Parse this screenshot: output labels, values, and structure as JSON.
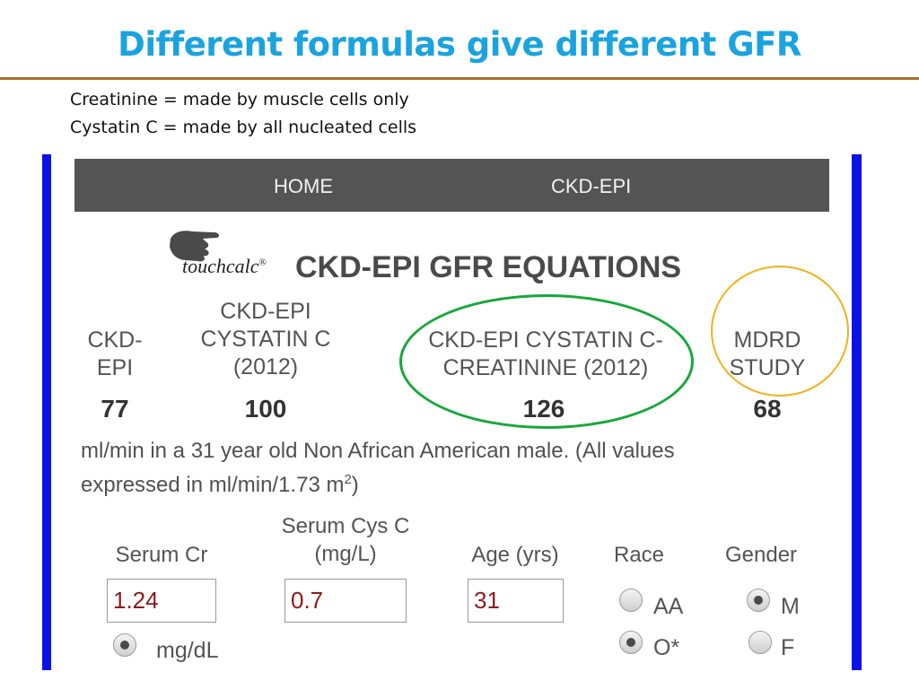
{
  "slide": {
    "title": "Different formulas give different GFR",
    "notes": [
      "Creatinine = made by muscle cells only",
      "Cystatin C = made by all nucleated cells"
    ]
  },
  "nav": {
    "items": [
      "HOME",
      "CKD-EPI"
    ]
  },
  "app": {
    "brand": "touchcalc",
    "brand_mark": "®",
    "title": "CKD-EPI GFR EQUATIONS"
  },
  "results": [
    {
      "label_lines": [
        "CKD-",
        "EPI"
      ],
      "value": "77"
    },
    {
      "label_lines": [
        "CKD-EPI",
        "CYSTATIN C",
        "(2012)"
      ],
      "value": "100"
    },
    {
      "label_lines": [
        "CKD-EPI CYSTATIN C-",
        "CREATININE (2012)"
      ],
      "value": "126"
    },
    {
      "label_lines": [
        "MDRD",
        "STUDY"
      ],
      "value": "68"
    }
  ],
  "description": {
    "line1": "ml/min in a 31 year old Non African American male. (All values",
    "line2": "expressed in ml/min/1.73 m",
    "superscript": "2",
    "line2_end": ")"
  },
  "form": {
    "serum_cr": {
      "label": "Serum Cr",
      "value": "1.24"
    },
    "serum_cys": {
      "label_lines": [
        "Serum Cys C",
        "(mg/L)"
      ],
      "value": "0.7"
    },
    "age": {
      "label": "Age (yrs)",
      "value": "31"
    },
    "units": {
      "label": "mg/dL",
      "checked": true
    },
    "race": {
      "label": "Race",
      "options": [
        {
          "label": "AA",
          "checked": false
        },
        {
          "label": "O*",
          "checked": true
        }
      ]
    },
    "gender": {
      "label": "Gender",
      "options": [
        {
          "label": "M",
          "checked": true
        },
        {
          "label": "F",
          "checked": false
        }
      ]
    }
  },
  "colors": {
    "title": "#1aa3de",
    "rule": "#b06d2c",
    "frame": "#0a12e6",
    "navbar": "#545454",
    "highlight_green": "#16a83a",
    "highlight_gold": "#f1b21c",
    "input_text": "#8c1a1a"
  },
  "icons": {
    "hand": "pointing-hand-icon"
  }
}
